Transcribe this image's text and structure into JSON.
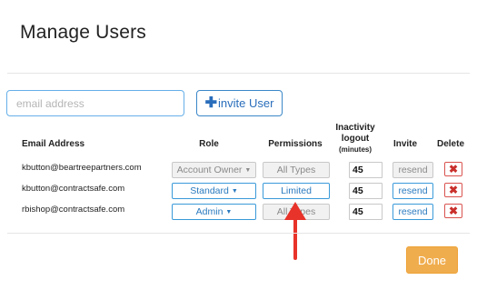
{
  "modal": {
    "title": "Manage Users"
  },
  "add_user": {
    "email_placeholder": "email address",
    "invite_label": "invite User",
    "invite_icon": "plus-icon"
  },
  "table": {
    "headers": {
      "email": "Email Address",
      "role": "Role",
      "permissions": "Permissions",
      "inactivity_line1": "Inactivity",
      "inactivity_line2": "logout",
      "inactivity_line3": "(minutes)",
      "invite": "Invite",
      "delete": "Delete"
    },
    "rows": [
      {
        "email": "kbutton@beartreepartners.com",
        "role": "Account Owner",
        "role_enabled": false,
        "permissions": "All Types",
        "permissions_enabled": false,
        "inactivity": "45",
        "invite": "resend",
        "invite_enabled": false
      },
      {
        "email": "kbutton@contractsafe.com",
        "role": "Standard",
        "role_enabled": true,
        "permissions": "Limited",
        "permissions_enabled": true,
        "inactivity": "45",
        "invite": "resend",
        "invite_enabled": true
      },
      {
        "email": "rbishop@contractsafe.com",
        "role": "Admin",
        "role_enabled": true,
        "permissions": "All Types",
        "permissions_enabled": false,
        "inactivity": "45",
        "invite": "resend",
        "invite_enabled": true
      }
    ]
  },
  "footer": {
    "done_label": "Done"
  },
  "colors": {
    "primary": "#2a7abf",
    "danger": "#d9534f",
    "warning": "#f0ad4e",
    "annotation_arrow": "#e8332a"
  }
}
